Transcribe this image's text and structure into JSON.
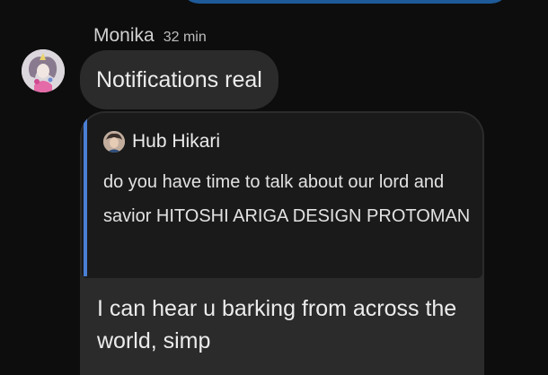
{
  "colors": {
    "background": "#0d0d0d",
    "bubble": "#2b2b2b",
    "quote_background": "#1a1a1a",
    "quote_bar": "#4a7fd4",
    "outgoing_bubble": "#1e5a99"
  },
  "message_group": {
    "sender_name": "Monika",
    "timestamp": "32 min",
    "avatar_icon": "anime-character-avatar-icon"
  },
  "messages": [
    {
      "text": "Notifications real"
    },
    {
      "quote": {
        "author": "Hub Hikari",
        "author_avatar_icon": "user-avatar-icon",
        "text": "do you have time to talk about our lord and savior HITOSHI ARIGA DESIGN PROTOMAN"
      },
      "text": "I can hear u barking from across the world, simp"
    }
  ]
}
